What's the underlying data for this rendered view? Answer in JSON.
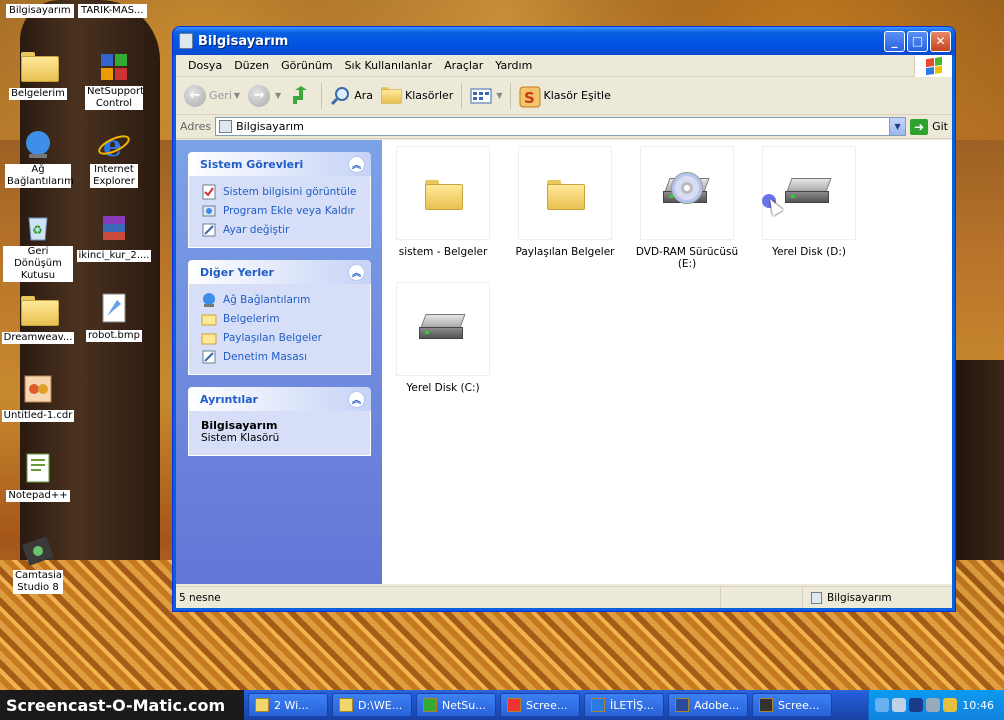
{
  "desktop": {
    "top_labels": [
      "Bilgisayarım",
      "TARIK-MAS..."
    ],
    "icons": [
      {
        "label": "Belgelerim",
        "icon": "folder-icon"
      },
      {
        "label": "NetSupport Control",
        "icon": "netsupport-icon"
      },
      {
        "label": "Ağ Bağlantılarım",
        "icon": "network-icon"
      },
      {
        "label": "Internet Explorer",
        "icon": "ie-icon"
      },
      {
        "label": "Geri Dönüşüm Kutusu",
        "icon": "recycle-bin-icon"
      },
      {
        "label": "ikinci_kur_2....",
        "icon": "winrar-icon"
      },
      {
        "label": "Dreamweav...",
        "icon": "folder-icon"
      },
      {
        "label": "robot.bmp",
        "icon": "bitmap-icon"
      },
      {
        "label": "Untitled-1.cdr",
        "icon": "coreldraw-icon"
      },
      {
        "label": "Notepad++",
        "icon": "notepadpp-icon"
      },
      {
        "label": "Camtasia Studio 8",
        "icon": "camtasia-icon"
      }
    ]
  },
  "window": {
    "title": "Bilgisayarım",
    "menu": [
      "Dosya",
      "Düzen",
      "Görünüm",
      "Sık Kullanılanlar",
      "Araçlar",
      "Yardım"
    ],
    "toolbar": {
      "back": "Geri",
      "search": "Ara",
      "folders": "Klasörler",
      "sync": "Klasör Eşitle"
    },
    "address": {
      "label": "Adres",
      "value": "Bilgisayarım",
      "go": "Git"
    },
    "panels": {
      "system_tasks": {
        "title": "Sistem Görevleri",
        "items": [
          "Sistem bilgisini görüntüle",
          "Program Ekle veya Kaldır",
          "Ayar değiştir"
        ]
      },
      "other_places": {
        "title": "Diğer Yerler",
        "items": [
          "Ağ Bağlantılarım",
          "Belgelerim",
          "Paylaşılan Belgeler",
          "Denetim Masası"
        ]
      },
      "details": {
        "title": "Ayrıntılar",
        "name": "Bilgisayarım",
        "type": "Sistem Klasörü"
      }
    },
    "items": [
      {
        "name": "sistem - Belgeler",
        "kind": "folder"
      },
      {
        "name": "Paylaşılan Belgeler",
        "kind": "folder"
      },
      {
        "name": "DVD-RAM Sürücüsü (E:)",
        "kind": "dvd"
      },
      {
        "name": "Yerel Disk (D:)",
        "kind": "disk"
      },
      {
        "name": "Yerel Disk (C:)",
        "kind": "disk"
      }
    ],
    "status": {
      "count": "5 nesne",
      "location": "Bilgisayarım"
    }
  },
  "taskbar": {
    "brand": "Screencast-O-Matic.com",
    "tasks": [
      "2 Wi...",
      "D:\\WE...",
      "NetSu...",
      "Scree...",
      "İLETİŞ...",
      "Adobe...",
      "Scree..."
    ],
    "clock": "10:46"
  }
}
